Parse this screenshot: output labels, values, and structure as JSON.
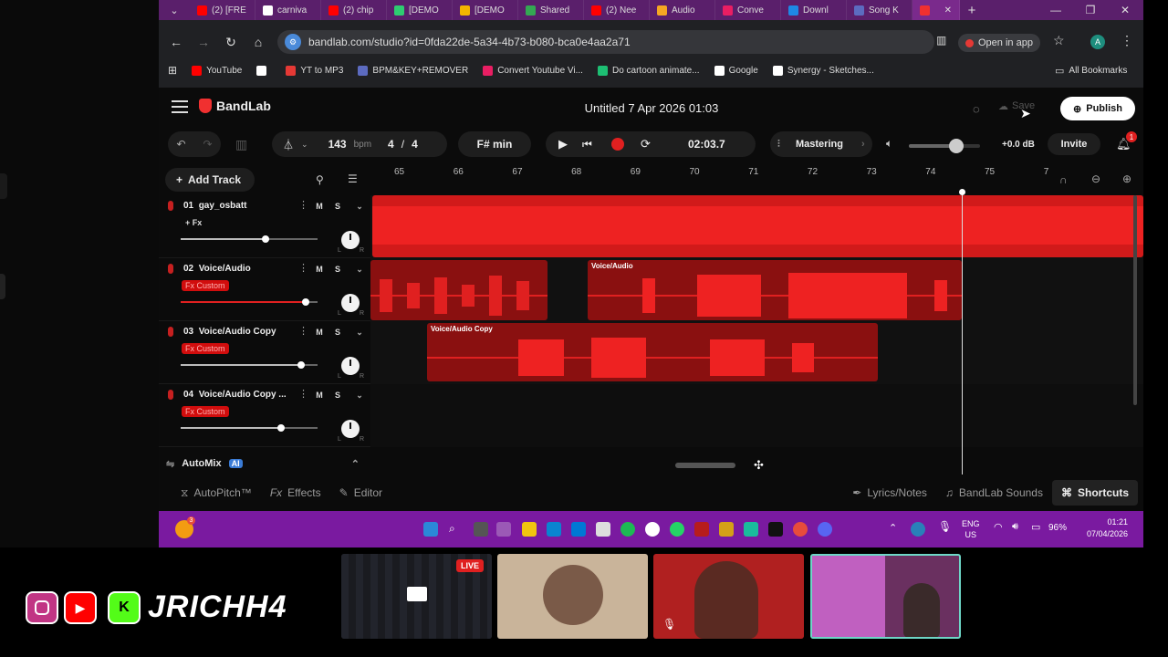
{
  "browser": {
    "tabs": [
      {
        "label": "(2) [FRE",
        "icon": "youtube-icon",
        "color": "#ff0000"
      },
      {
        "label": "carniva",
        "icon": "google-icon",
        "color": "#ffffff"
      },
      {
        "label": "(2) chip",
        "icon": "youtube-icon",
        "color": "#ff0000"
      },
      {
        "label": "[DEMO",
        "icon": "z-icon",
        "color": "#2ecc71"
      },
      {
        "label": "[DEMO",
        "icon": "drive-icon",
        "color": "#f4b400"
      },
      {
        "label": "Shared",
        "icon": "drive-icon",
        "color": "#34a853"
      },
      {
        "label": "(2) Nee",
        "icon": "youtube-icon",
        "color": "#ff0000"
      },
      {
        "label": "Audio",
        "icon": "audio-icon",
        "color": "#f5a623"
      },
      {
        "label": "Conve",
        "icon": "download-icon",
        "color": "#e91e63"
      },
      {
        "label": "Downl",
        "icon": "download-icon",
        "color": "#1e88e5"
      },
      {
        "label": "Song K",
        "icon": "v-icon",
        "color": "#5c6bc0"
      },
      {
        "label": "",
        "icon": "bandlab-icon",
        "color": "#f03030"
      }
    ],
    "url": "bandlab.com/studio?id=0fda22de-5a34-4b73-b080-bca0e4aa2a71",
    "open_in_app": "Open in app",
    "profile_initial": "A",
    "bookmarks": [
      {
        "label": "YouTube",
        "color": "#ff0000"
      },
      {
        "label": "",
        "color": "#ffffff"
      },
      {
        "label": "YT to MP3",
        "color": "#e53935"
      },
      {
        "label": "BPM&KEY+REMOVER",
        "color": "#5c6bc0"
      },
      {
        "label": "Convert Youtube Vi...",
        "color": "#e91e63"
      },
      {
        "label": "Do cartoon animate...",
        "color": "#1dbf73"
      },
      {
        "label": "Google",
        "color": "#ffffff"
      },
      {
        "label": "Synergy - Sketches...",
        "color": "#ffffff"
      }
    ],
    "all_bookmarks": "All Bookmarks"
  },
  "studio": {
    "logo": "BandLab",
    "project_title": "Untitled 7 Apr 2026 01:03",
    "save": "Save",
    "publish": "Publish",
    "bpm": "143",
    "bpm_unit": "bpm",
    "time_sig_num": "4",
    "time_sig_den": "4",
    "key": "F# min",
    "time": "02:03.7",
    "mastering": "Mastering",
    "db": "+0.0 dB",
    "invite": "Invite",
    "notif_count": "1",
    "add_track": "Add Track",
    "ruler": [
      "65",
      "66",
      "67",
      "68",
      "69",
      "70",
      "71",
      "72",
      "73",
      "74",
      "75",
      "7"
    ],
    "tracks": [
      {
        "num": "01",
        "name": "gay_osbatt",
        "fx": "+ Fx",
        "fx_custom": false,
        "volume": 0.62
      },
      {
        "num": "02",
        "name": "Voice/Audio",
        "fx": "Fx Custom",
        "fx_custom": true,
        "volume": 0.91
      },
      {
        "num": "03",
        "name": "Voice/Audio Copy",
        "fx": "Fx Custom",
        "fx_custom": true,
        "volume": 0.88
      },
      {
        "num": "04",
        "name": "Voice/Audio Copy ...",
        "fx": "Fx Custom",
        "fx_custom": true,
        "volume": 0.73
      }
    ],
    "clip_labels": {
      "voice": "Voice/Audio",
      "voice_copy": "Voice/Audio Copy"
    },
    "mute": "M",
    "solo": "S",
    "pan_l": "L",
    "pan_r": "R",
    "automix": "AutoMix",
    "ai": "AI",
    "autopitch": "AutoPitch™",
    "effects": "Effects",
    "fx_prefix": "Fx",
    "editor": "Editor",
    "lyrics": "Lyrics/Notes",
    "sounds": "BandLab Sounds",
    "shortcuts": "Shortcuts"
  },
  "taskbar": {
    "lang1": "ENG",
    "lang2": "US",
    "battery": "96%",
    "clock_time": "01:21",
    "clock_date": "07/04/2026",
    "badge": "3"
  },
  "stream": {
    "live": "LIVE",
    "handle": "JRICHH4"
  }
}
